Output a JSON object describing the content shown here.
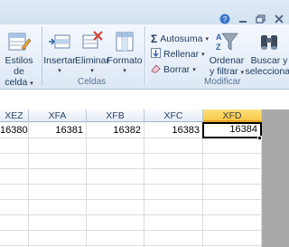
{
  "ribbon": {
    "estilos": {
      "line1": "Estilos de",
      "line2": "celda"
    },
    "insertar": {
      "label": "Insertar"
    },
    "eliminar": {
      "label": "Eliminar"
    },
    "formato": {
      "label": "Formato"
    },
    "celdas_group": "Celdas",
    "autosuma": "Autosuma",
    "rellenar": "Rellenar",
    "borrar": "Borrar",
    "ordenar": {
      "line1": "Ordenar",
      "line2": "y filtrar"
    },
    "buscar": {
      "line1": "Buscar y",
      "line2": "seleccionar"
    },
    "modificar_group": "Modificar",
    "dropdown_glyph": "▾"
  },
  "columns": [
    "XEZ",
    "XFA",
    "XFB",
    "XFC",
    "XFD"
  ],
  "selected_column": "XFD",
  "row1": [
    "16380",
    "16381",
    "16382",
    "16383",
    "16384"
  ],
  "colors": {
    "selected_header": "#f9c94b",
    "gridline": "#dadcdd",
    "ribbon": "#dde8f5"
  }
}
